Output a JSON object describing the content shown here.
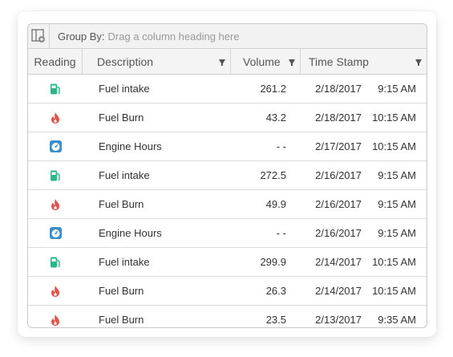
{
  "group_bar": {
    "label": "Group By:",
    "hint": "Drag a column heading here"
  },
  "columns": {
    "reading": "Reading",
    "description": "Description",
    "volume": "Volume",
    "timestamp": "Time Stamp"
  },
  "colors": {
    "fuel": "#2bb58a",
    "burn": "#e0534a",
    "hours": "#3a8fc9"
  },
  "rows": [
    {
      "icon": "fuel-pump-icon",
      "description": "Fuel intake",
      "volume": "261.2",
      "date": "2/18/2017",
      "time": "9:15 AM"
    },
    {
      "icon": "flame-icon",
      "description": "Fuel Burn",
      "volume": "43.2",
      "date": "2/18/2017",
      "time": "10:15 AM"
    },
    {
      "icon": "gauge-icon",
      "description": "Engine Hours",
      "volume": "- -",
      "date": "2/17/2017",
      "time": "10:15 AM"
    },
    {
      "icon": "fuel-pump-icon",
      "description": "Fuel intake",
      "volume": "272.5",
      "date": "2/16/2017",
      "time": "9:15 AM"
    },
    {
      "icon": "flame-icon",
      "description": "Fuel Burn",
      "volume": "49.9",
      "date": "2/16/2017",
      "time": "9:15 AM"
    },
    {
      "icon": "gauge-icon",
      "description": "Engine Hours",
      "volume": "- -",
      "date": "2/16/2017",
      "time": "9:15 AM"
    },
    {
      "icon": "fuel-pump-icon",
      "description": "Fuel intake",
      "volume": "299.9",
      "date": "2/14/2017",
      "time": "10:15 AM"
    },
    {
      "icon": "flame-icon",
      "description": "Fuel Burn",
      "volume": "26.3",
      "date": "2/14/2017",
      "time": "10:15 AM"
    },
    {
      "icon": "flame-icon",
      "description": "Fuel Burn",
      "volume": "23.5",
      "date": "2/13/2017",
      "time": "9:35 AM"
    }
  ]
}
